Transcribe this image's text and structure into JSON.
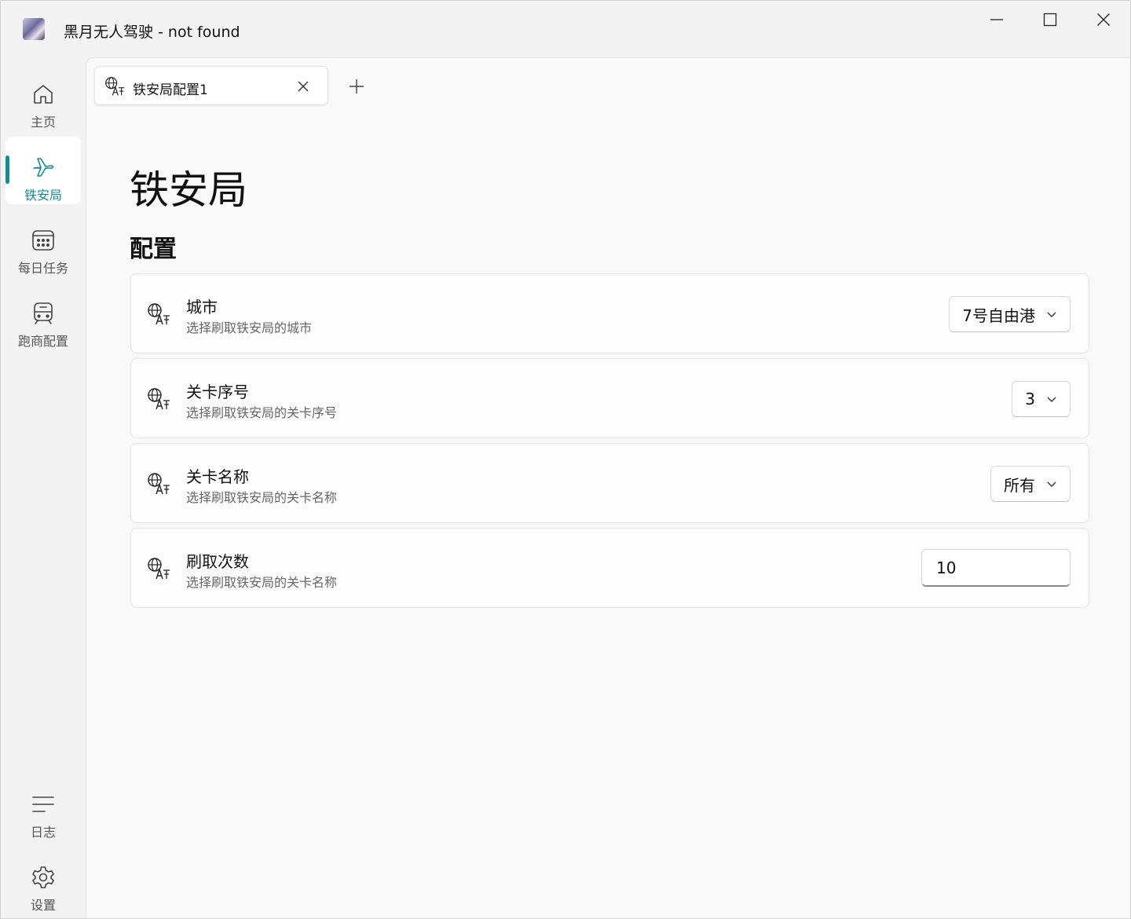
{
  "window": {
    "title": "黑月无人驾驶 - not found"
  },
  "sidebar": {
    "items": [
      {
        "label": "主页",
        "icon": "home-icon"
      },
      {
        "label": "铁安局",
        "icon": "airplane-icon",
        "active": true
      },
      {
        "label": "每日任务",
        "icon": "calendar-icon"
      },
      {
        "label": "跑商配置",
        "icon": "train-icon"
      }
    ],
    "bottom_items": [
      {
        "label": "日志",
        "icon": "lines-icon"
      },
      {
        "label": "设置",
        "icon": "gear-icon"
      }
    ]
  },
  "tabs": [
    {
      "label": "铁安局配置1",
      "icon": "translate-icon"
    }
  ],
  "page": {
    "title": "铁安局",
    "section_title": "配置"
  },
  "settings": [
    {
      "title": "城市",
      "description": "选择刷取铁安局的城市",
      "control": "combo",
      "value": "7号自由港"
    },
    {
      "title": "关卡序号",
      "description": "选择刷取铁安局的关卡序号",
      "control": "combo",
      "value": "3"
    },
    {
      "title": "关卡名称",
      "description": "选择刷取铁安局的关卡名称",
      "control": "combo",
      "value": "所有"
    },
    {
      "title": "刷取次数",
      "description": "选择刷取铁安局的关卡名称",
      "control": "textbox",
      "value": "10"
    }
  ],
  "colors": {
    "accent": "#0f8f91",
    "background": "#f3f3f3",
    "content_background": "#f9f9f9"
  }
}
